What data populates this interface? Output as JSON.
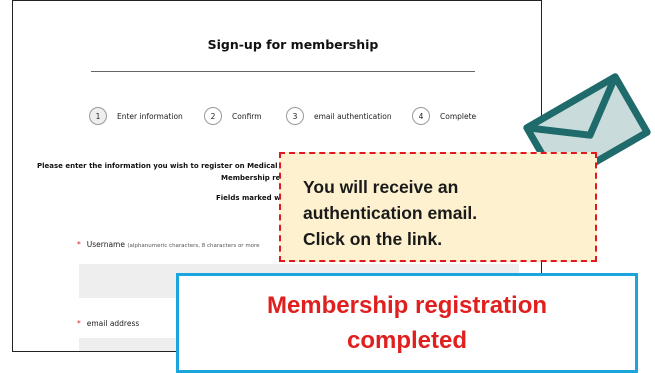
{
  "form": {
    "title": "Sign-up for membership",
    "steps": [
      {
        "number": "1",
        "label": "Enter information",
        "active": true
      },
      {
        "number": "2",
        "label": "Confirm",
        "active": false
      },
      {
        "number": "3",
        "label": "email authentication",
        "active": false
      },
      {
        "number": "4",
        "label": "Complete",
        "active": false
      }
    ],
    "intro_line1": "Please enter the information you wish to register on Medical Pri",
    "intro_line2": "Membership re",
    "intro_line3": "Fields marked w",
    "fields": [
      {
        "required_mark": "*",
        "label": "Username",
        "hint": "(alphanumeric characters, 8 characters or more"
      },
      {
        "required_mark": "*",
        "label": "email address",
        "hint": ""
      }
    ]
  },
  "callout": {
    "line1": "You will receive an",
    "line2": "authentication email.",
    "line3": "Click on the link."
  },
  "banner": {
    "line1": "Membership registration",
    "line2": "completed"
  },
  "colors": {
    "callout_border": "#e0181f",
    "callout_fill": "#fdf1cf",
    "banner_border": "#1aa6dd",
    "banner_text": "#e0201f",
    "envelope_stroke": "#1f6b6b",
    "envelope_fill": "#c9dcdb"
  },
  "icons": {
    "envelope": "envelope-icon"
  }
}
